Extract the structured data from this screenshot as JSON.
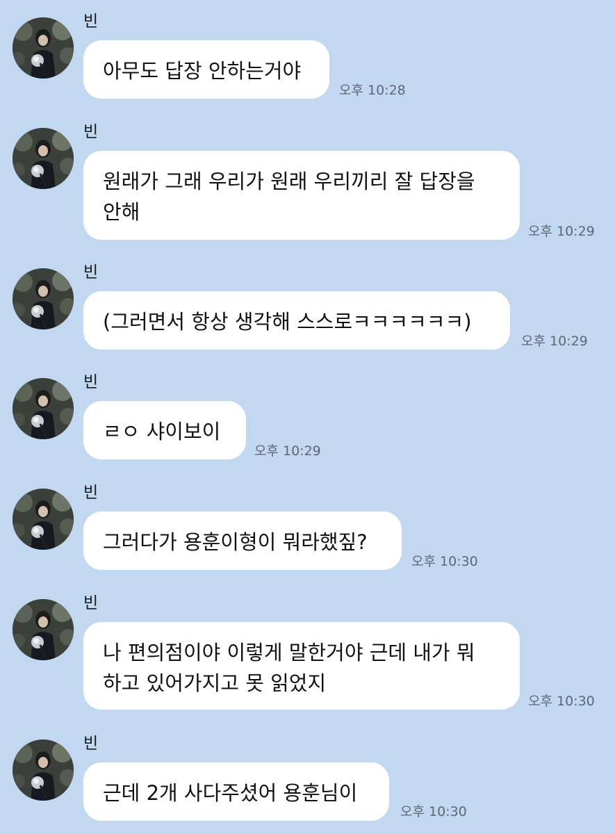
{
  "messages": [
    {
      "sender": "빈",
      "text": "아무도 답장 안하는거야",
      "time": "오후 10:28"
    },
    {
      "sender": "빈",
      "text": "원래가 그래 우리가 원래 우리끼리 잘 답장을\n안해",
      "time": "오후 10:29"
    },
    {
      "sender": "빈",
      "text": "(그러면서 항상 생각해 스스로ㅋㅋㅋㅋㅋㅋ)",
      "time": "오후 10:29"
    },
    {
      "sender": "빈",
      "text": "ㄹㅇ 샤이보이",
      "time": "오후 10:29"
    },
    {
      "sender": "빈",
      "text": "그러다가 용훈이형이 뭐라했짚?",
      "time": "오후 10:30"
    },
    {
      "sender": "빈",
      "text": "나 편의점이야 이렇게 말한거야 근데 내가 뭐\n하고 있어가지고 못 읽었지",
      "time": "오후 10:30"
    },
    {
      "sender": "빈",
      "text": "근데 2개 사다주셨어 용훈님이",
      "time": "오후 10:30"
    }
  ]
}
